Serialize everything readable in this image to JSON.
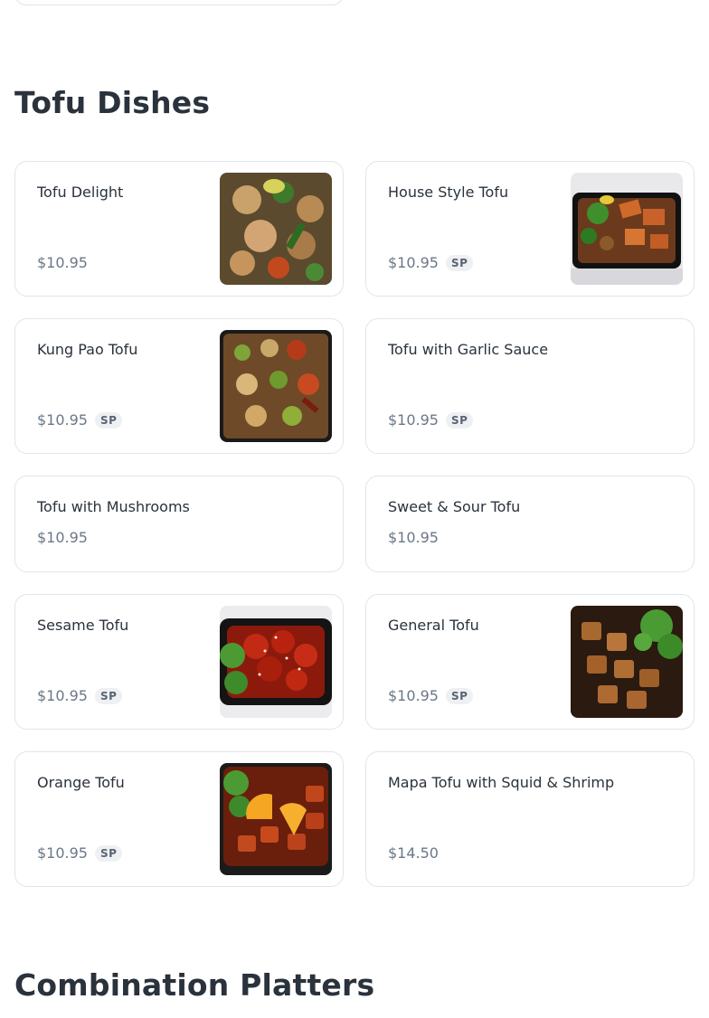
{
  "sections": {
    "tofu_title": "Tofu Dishes",
    "combo_title": "Combination Platters"
  },
  "items": [
    {
      "name": "Tofu Delight",
      "price": "$10.95",
      "badge": "",
      "image": "food-photo-mixed-vegetables-tofu"
    },
    {
      "name": "House Style Tofu",
      "price": "$10.95",
      "badge": "SP",
      "image": "food-photo-house-tofu"
    },
    {
      "name": "Kung Pao Tofu",
      "price": "$10.95",
      "badge": "SP",
      "image": "food-photo-kung-pao-tofu"
    },
    {
      "name": "Tofu with Garlic Sauce",
      "price": "$10.95",
      "badge": "SP",
      "image": ""
    },
    {
      "name": "Tofu with Mushrooms",
      "price": "$10.95",
      "badge": "",
      "image": ""
    },
    {
      "name": "Sweet & Sour Tofu",
      "price": "$10.95",
      "badge": "",
      "image": ""
    },
    {
      "name": "Sesame Tofu",
      "price": "$10.95",
      "badge": "SP",
      "image": "food-photo-sesame-tofu"
    },
    {
      "name": "General Tofu",
      "price": "$10.95",
      "badge": "SP",
      "image": "food-photo-general-tofu"
    },
    {
      "name": "Orange Tofu",
      "price": "$10.95",
      "badge": "SP",
      "image": "food-photo-orange-tofu"
    },
    {
      "name": "Mapa Tofu with Squid & Shrimp",
      "price": "$14.50",
      "badge": "",
      "image": ""
    }
  ],
  "colors": {
    "title": "#2a323c",
    "price": "#6b7787",
    "badge_bg": "#eef0f3",
    "border": "#e2e4e8"
  }
}
